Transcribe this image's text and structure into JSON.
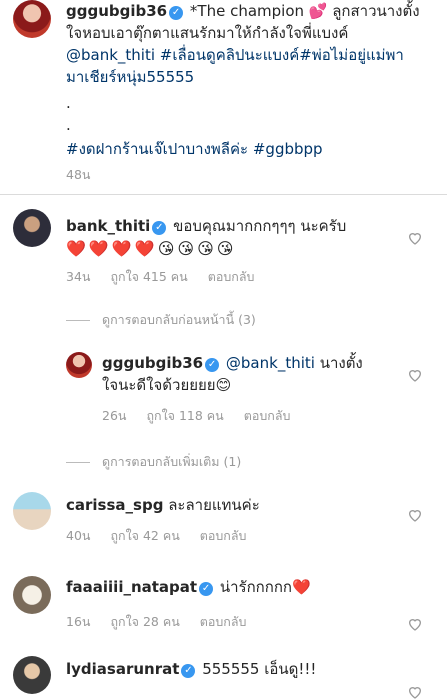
{
  "caption": {
    "username": "gggubgib36",
    "line1": "*The champion 💕 ลูกสาวนางตั้ง",
    "line2": "ใจหอบเอาตุ๊กตาแสนรักมาให้กำลังใจพี่แบงค์",
    "line3_mention": "@bank_thiti",
    "line3_tags": "#เลื่อนดูคลิปนะแบงค์#พ่อไม่อยู่แม่พา",
    "line4_tag": "มาเชียร์หนุ่ม55555",
    "dot1": ".",
    "dot2": ".",
    "tags": "#งดฝากร้านเจ๊เปาบางพลีค่ะ #ggbbpp",
    "time": "48น"
  },
  "comments": [
    {
      "username": "bank_thiti",
      "text": "ขอบคุณมากกกๆๆๆ นะครับ",
      "emoji": [
        "❤️",
        "❤️",
        "❤️",
        "❤️",
        "😘",
        "😘",
        "😘",
        "😘"
      ],
      "time": "34น",
      "likes": "ถูกใจ 415 คน",
      "reply": "ตอบกลับ"
    }
  ],
  "view_prev_replies": "ดูการตอบกลับก่อนหน้านี้ (3)",
  "reply": {
    "username": "gggubgib36",
    "mention": "@bank_thiti",
    "text1": " นางตั้ง",
    "text2": "ใจนะดีใจด้วยยยย😊",
    "time": "26น",
    "likes": "ถูกใจ 118 คน",
    "reply": "ตอบกลับ"
  },
  "view_more_replies": "ดูการตอบกลับเพิ่มเติม (1)",
  "others": [
    {
      "username": "carissa_spg",
      "text": " ละลายแทนค่ะ",
      "time": "40น",
      "likes": "ถูกใจ 42 คน",
      "reply": "ตอบกลับ"
    },
    {
      "username": "faaaiiii_natapat",
      "text": " น่ารักกกกก❤️",
      "time": "16น",
      "likes": "ถูกใจ 28 คน",
      "reply": "ตอบกลับ"
    },
    {
      "username": "lydiasarunrat",
      "text": " 555555 เอ็นดู!!!"
    }
  ],
  "colors": {
    "verified": "#3897f0",
    "link": "#003569",
    "muted": "#999999"
  }
}
